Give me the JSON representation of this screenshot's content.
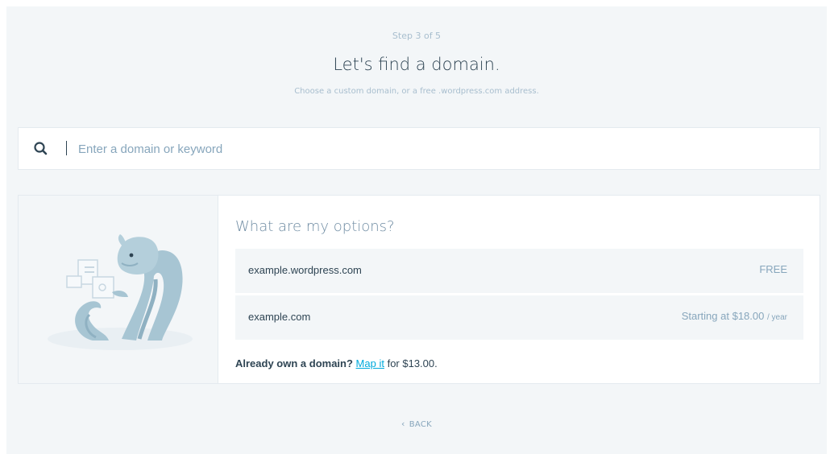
{
  "header": {
    "step": "Step 3 of 5",
    "title": "Let's find a domain.",
    "subtitle": "Choose a custom domain, or a free .wordpress.com address."
  },
  "search": {
    "placeholder": "Enter a domain or keyword",
    "value": "",
    "icon": "search-icon"
  },
  "options": {
    "title": "What are my options?",
    "rows": [
      {
        "domain": "example.wordpress.com",
        "price": "FREE",
        "per": ""
      },
      {
        "domain": "example.com",
        "price": "Starting at $18.00",
        "per": "/ year"
      }
    ],
    "own_domain": {
      "lead": "Already own a domain?",
      "link": "Map it",
      "tail": "for $13.00."
    }
  },
  "footer": {
    "back": "BACK",
    "back_icon": "chevron-left-icon"
  },
  "colors": {
    "background": "#f3f6f8",
    "text": "#2e4453",
    "muted": "#87a6bc",
    "link": "#00aadc",
    "illustration": "#a7c5d3"
  }
}
